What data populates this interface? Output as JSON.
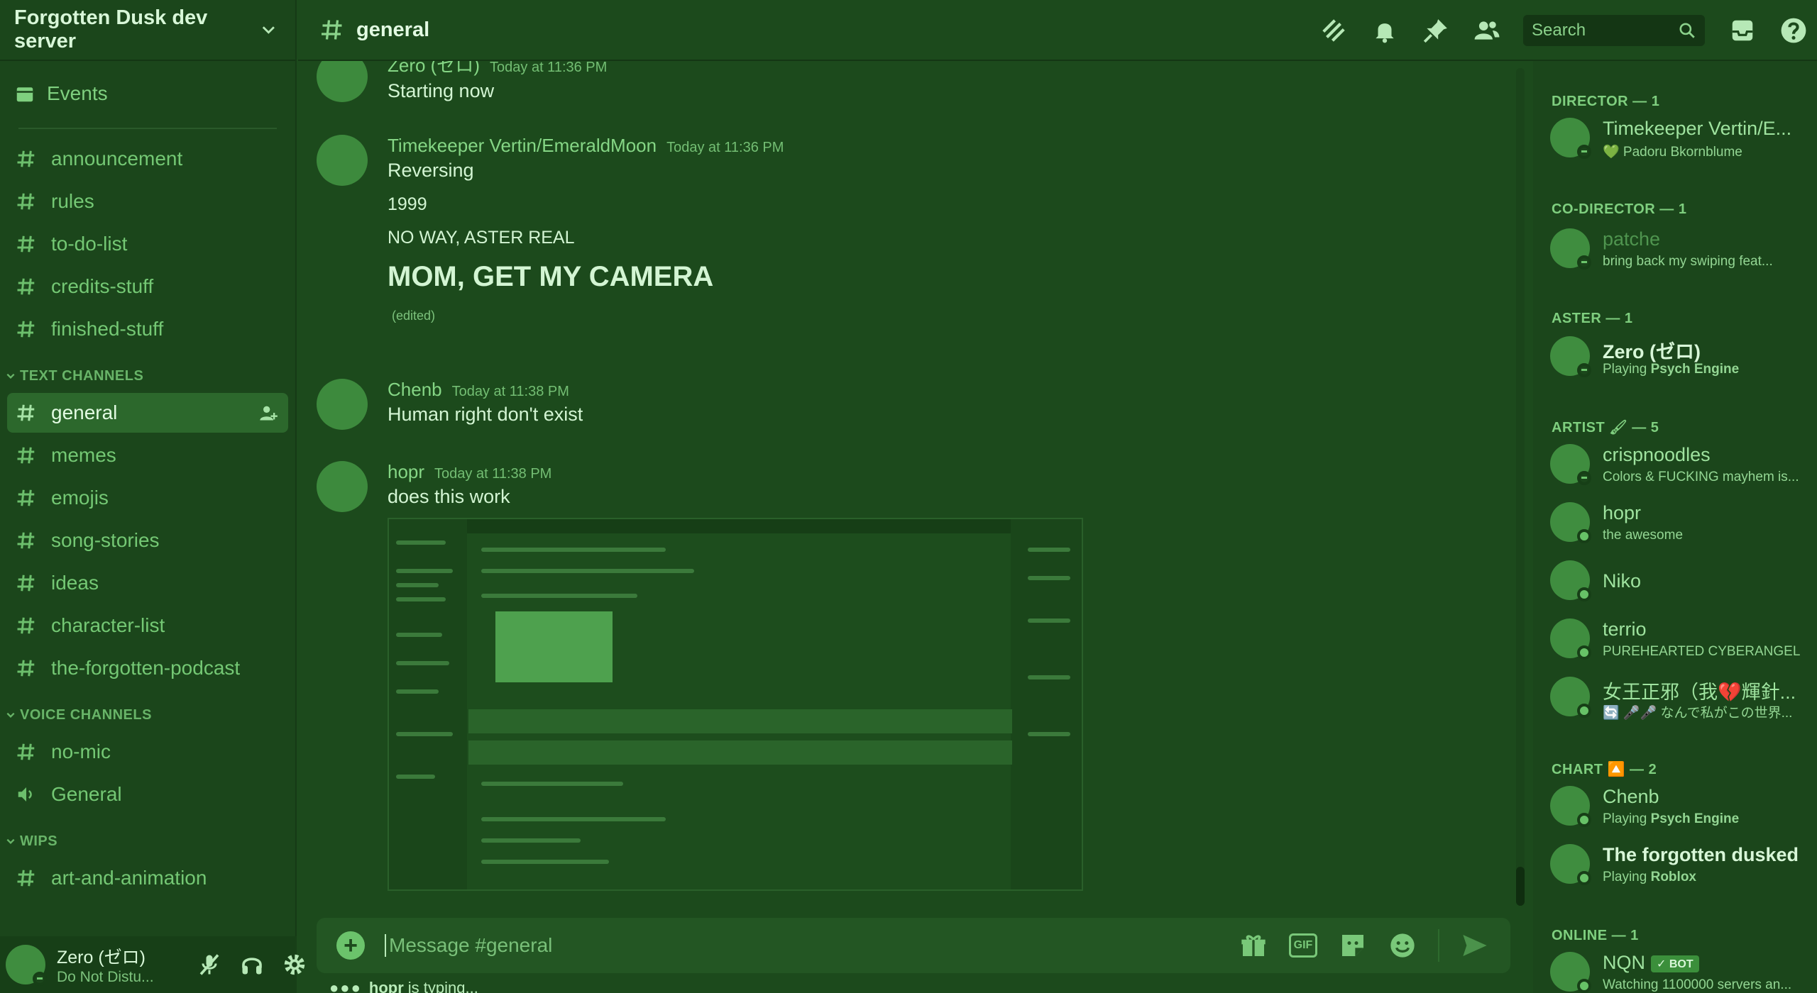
{
  "server": {
    "name": "Forgotten Dusk dev server"
  },
  "sidebar": {
    "events_label": "Events",
    "top_channels": [
      "announcement",
      "rules",
      "to-do-list",
      "credits-stuff",
      "finished-stuff"
    ],
    "categories": [
      {
        "label": "TEXT CHANNELS",
        "channels": [
          "general",
          "memes",
          "emojis",
          "song-stories",
          "ideas",
          "character-list",
          "the-forgotten-podcast"
        ]
      },
      {
        "label": "VOICE CHANNELS",
        "channels": [
          "no-mic",
          "General"
        ]
      },
      {
        "label": "WIPS",
        "channels": [
          "art-and-animation"
        ]
      }
    ]
  },
  "user_panel": {
    "name": "Zero (ゼロ)",
    "status": "Do Not Distu..."
  },
  "topbar": {
    "channel": "general",
    "search_placeholder": "Search"
  },
  "messages": [
    {
      "author": "Zero (ゼロ)",
      "time": "Today at 11:36 PM",
      "lines": [
        "Starting now"
      ]
    },
    {
      "author": "Timekeeper Vertin/EmeraldMoon",
      "time": "Today at 11:36 PM",
      "lines": [
        "Reversing",
        "1999",
        "NO WAY, ASTER REAL",
        "MOM, GET MY CAMERA"
      ],
      "edited": "(edited)"
    },
    {
      "author": "Chenb",
      "time": "Today at 11:38 PM",
      "lines": [
        "Human right don't exist"
      ]
    },
    {
      "author": "hopr",
      "time": "Today at 11:38 PM",
      "lines": [
        "does this work"
      ]
    }
  ],
  "composer": {
    "placeholder": "Message #general",
    "gif_label": "GIF"
  },
  "typing": {
    "user": "hopr",
    "text": "is typing..."
  },
  "members": {
    "roles": [
      {
        "header": "DIRECTOR — 1",
        "members": [
          {
            "name": "Timekeeper Vertin/E...",
            "status": "💚 Padoru Bkornblume"
          }
        ]
      },
      {
        "header": "CO-DIRECTOR — 1",
        "members": [
          {
            "name": "patche",
            "status": "bring back my swiping feat..."
          }
        ]
      },
      {
        "header": "ASTER — 1",
        "members": [
          {
            "name": "Zero (ゼロ)",
            "status_prefix": "Playing",
            "status_bold": "Psych Engine"
          }
        ]
      },
      {
        "header": "ARTIST 🖌 — 5",
        "members": [
          {
            "name": "crispnoodles",
            "status": "Colors & FUCKING mayhem is..."
          },
          {
            "name": "hopr",
            "status": "the awesome"
          },
          {
            "name": "Niko",
            "status": ""
          },
          {
            "name": "terrio",
            "status": "PUREHEARTED CYBERANGEL"
          },
          {
            "name": "女王正邪（我💔輝針...",
            "status": "🔄 🎤🎤 なんで私がこの世界..."
          }
        ]
      },
      {
        "header": "CHART 🔼 — 2",
        "members": [
          {
            "name": "Chenb",
            "status_prefix": "Playing",
            "status_bold": "Psych Engine"
          },
          {
            "name": "The forgotten dusked",
            "status_prefix": "Playing",
            "status_bold": "Roblox"
          }
        ]
      },
      {
        "header": "ONLINE — 1",
        "members": [
          {
            "name": "NQN",
            "badge": "✓ BOT",
            "status": "Watching 1100000 servers an..."
          }
        ]
      }
    ]
  },
  "colors": {
    "theme_tint": "#1c4a1c",
    "accent": "#6bc36b"
  }
}
